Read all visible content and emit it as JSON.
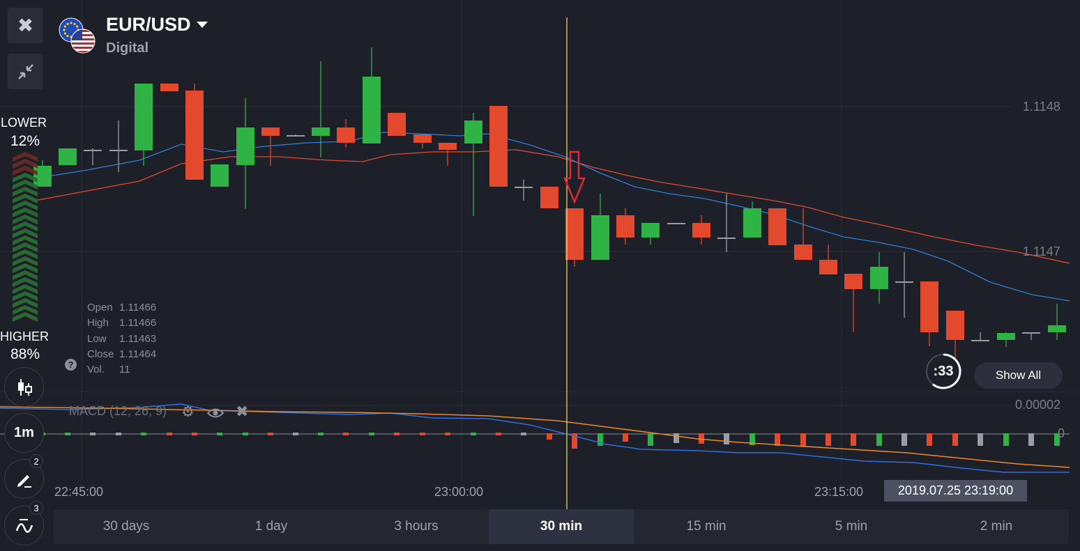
{
  "header": {
    "asset": "EUR/USD",
    "asset_type": "Digital"
  },
  "sentiment": {
    "lower_label": "LOWER",
    "lower_value": "12%",
    "higher_label": "HIGHER",
    "higher_value": "88%"
  },
  "candle_info": {
    "open_label": "Open",
    "open": "1.11466",
    "high_label": "High",
    "high": "1.11466",
    "low_label": "Low",
    "low": "1.11463",
    "close_label": "Close",
    "close": "1.11464",
    "vol_label": "Vol.",
    "vol": "11"
  },
  "price_axis": [
    "1.1148",
    "1.1147"
  ],
  "macd": {
    "label": "MACD (12, 26, 9)",
    "axis": [
      "0.00002",
      "0"
    ]
  },
  "time_axis": [
    "22:45:00",
    "23:00:00",
    "23:15:00"
  ],
  "cursor_time": "2019.07.25 23:19:00",
  "countdown": ":33",
  "show_all": "Show All",
  "sidebar": {
    "interval": "1m",
    "drawings_count": "2",
    "indicators_count": "3"
  },
  "timeframes": [
    {
      "label": "30 days",
      "active": false
    },
    {
      "label": "1 day",
      "active": false
    },
    {
      "label": "3 hours",
      "active": false
    },
    {
      "label": "30 min",
      "active": true
    },
    {
      "label": "15 min",
      "active": false
    },
    {
      "label": "5 min",
      "active": false
    },
    {
      "label": "2 min",
      "active": false
    }
  ],
  "colors": {
    "up": "#2fb344",
    "down": "#e2492d",
    "neutral": "#9a9ca6",
    "ma_red": "#e2492d",
    "ma_blue": "#2b7fd6",
    "macd_line": "#2f6fe0",
    "signal_line": "#f08a1c",
    "cursor": "#f5e16a",
    "arrow": "#e8252a"
  },
  "icons": {
    "close": "close-icon",
    "minimize": "minimize-icon",
    "candles": "candles-icon",
    "draw": "pencil-icon",
    "indicators": "wave-icon",
    "settings": "gear-icon",
    "visibility": "eye-icon",
    "remove": "x-icon",
    "help": "question-icon",
    "dropdown": "chevron-down-icon"
  }
}
